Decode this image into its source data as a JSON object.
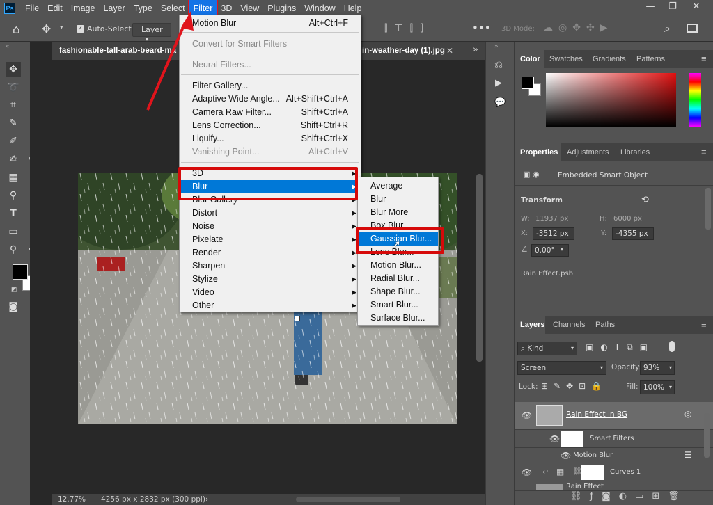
{
  "menubar": {
    "logo": "Ps",
    "items": [
      "File",
      "Edit",
      "Image",
      "Layer",
      "Type",
      "Select",
      "Filter",
      "3D",
      "View",
      "Plugins",
      "Window",
      "Help"
    ]
  },
  "options": {
    "auto_select_label": "Auto-Select:",
    "auto_select_target": "Layer",
    "mode_3d": "3D Mode:"
  },
  "doc": {
    "tab_left": "fashionable-tall-arab-beard-ma",
    "tab_right": "in-weather-day (1).jpg",
    "zoom": "12.77%",
    "dims": "4256 px x 2832 px (300 ppi)"
  },
  "filter_menu": {
    "top": [
      {
        "label": "Motion Blur",
        "sc": "Alt+Ctrl+F"
      }
    ],
    "smart": "Convert for Smart Filters",
    "neural": "Neural Filters...",
    "group": [
      {
        "label": "Filter Gallery...",
        "sc": ""
      },
      {
        "label": "Adaptive Wide Angle...",
        "sc": "Alt+Shift+Ctrl+A"
      },
      {
        "label": "Camera Raw Filter...",
        "sc": "Shift+Ctrl+A"
      },
      {
        "label": "Lens Correction...",
        "sc": "Shift+Ctrl+R"
      },
      {
        "label": "Liquify...",
        "sc": "Shift+Ctrl+X"
      },
      {
        "label": "Vanishing Point...",
        "sc": "Alt+Ctrl+V"
      }
    ],
    "subs": [
      "3D",
      "Blur",
      "Blur Gallery",
      "Distort",
      "Noise",
      "Pixelate",
      "Render",
      "Sharpen",
      "Stylize",
      "Video",
      "Other"
    ]
  },
  "blur_menu": [
    "Average",
    "Blur",
    "Blur More",
    "Box Blur...",
    "Gaussian Blur...",
    "Lens Blur...",
    "Motion Blur...",
    "Radial Blur...",
    "Shape Blur...",
    "Smart Blur...",
    "Surface Blur..."
  ],
  "color_panel": {
    "tabs": [
      "Color",
      "Swatches",
      "Gradients",
      "Patterns"
    ]
  },
  "properties": {
    "tabs": [
      "Properties",
      "Adjustments",
      "Libraries"
    ],
    "type": "Embedded Smart Object",
    "section": "Transform",
    "w_label": "W:",
    "w": "11937 px",
    "h_label": "H:",
    "h": "6000 px",
    "x_label": "X:",
    "x": "-3512 px",
    "y_label": "Y:",
    "y": "-4355 px",
    "angle": "0.00°",
    "file": "Rain Effect.psb"
  },
  "layers": {
    "tabs": [
      "Layers",
      "Channels",
      "Paths"
    ],
    "kind": "Kind",
    "blend": "Screen",
    "opacity_label": "Opacity:",
    "opacity": "93%",
    "lock_label": "Lock:",
    "fill_label": "Fill:",
    "fill": "100%",
    "rows": [
      {
        "name": "Rain Effect in BG"
      },
      {
        "name": "Smart Filters"
      },
      {
        "name": "Motion Blur"
      },
      {
        "name": "Curves 1"
      },
      {
        "name": "Rain Effect"
      }
    ]
  }
}
